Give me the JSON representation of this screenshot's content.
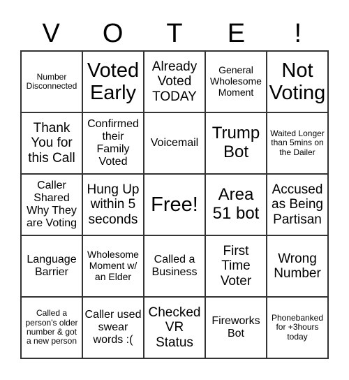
{
  "header": {
    "letters": [
      "V",
      "O",
      "T",
      "E",
      "!"
    ]
  },
  "board": {
    "cells": [
      {
        "text": "Number Disconnected",
        "size": "xs"
      },
      {
        "text": "Voted Early",
        "size": "xxl"
      },
      {
        "text": "Already Voted TODAY",
        "size": "lg"
      },
      {
        "text": "General Wholesome Moment",
        "size": "sm"
      },
      {
        "text": "Not Voting",
        "size": "xxl"
      },
      {
        "text": "Thank You for this Call",
        "size": "lg"
      },
      {
        "text": "Confirmed their Family Voted",
        "size": "md"
      },
      {
        "text": "Voicemail",
        "size": "md"
      },
      {
        "text": "Trump Bot",
        "size": "xl"
      },
      {
        "text": "Waited Longer than 5mins on the Dailer",
        "size": "xs"
      },
      {
        "text": "Caller Shared Why They are Voting",
        "size": "md"
      },
      {
        "text": "Hung Up within 5 seconds",
        "size": "lg"
      },
      {
        "text": "Free!",
        "size": "xxl"
      },
      {
        "text": "Area 51 bot",
        "size": "xl"
      },
      {
        "text": "Accused as Being Partisan",
        "size": "lg"
      },
      {
        "text": "Language Barrier",
        "size": "md"
      },
      {
        "text": "Wholesome Moment w/ an Elder",
        "size": "sm"
      },
      {
        "text": "Called a Business",
        "size": "md"
      },
      {
        "text": "First Time Voter",
        "size": "lg"
      },
      {
        "text": "Wrong Number",
        "size": "lg"
      },
      {
        "text": "Called a person's older number & got a new person",
        "size": "xs"
      },
      {
        "text": "Caller used swear words :(",
        "size": "md"
      },
      {
        "text": "Checked VR Status",
        "size": "lg"
      },
      {
        "text": "Fireworks Bot",
        "size": "md"
      },
      {
        "text": "Phonebanked for +3hours today",
        "size": "xs"
      }
    ]
  }
}
